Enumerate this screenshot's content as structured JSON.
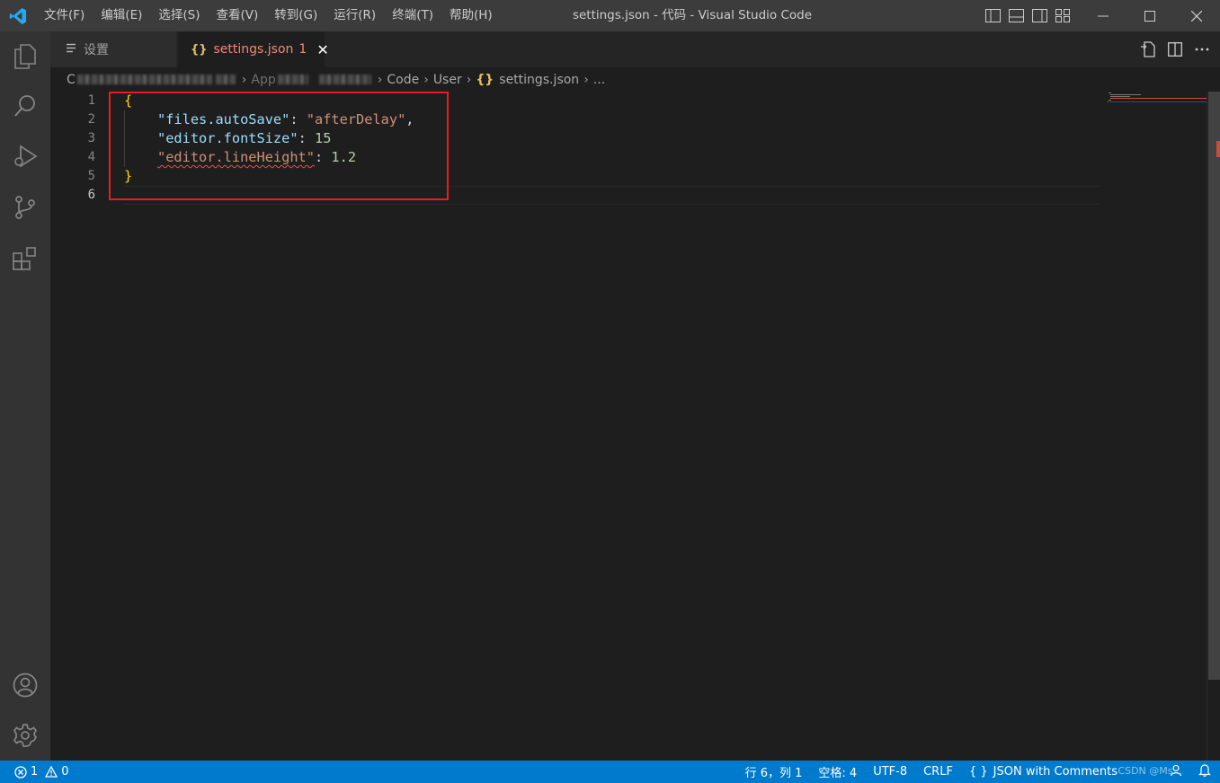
{
  "titlebar": {
    "menu": [
      "文件(F)",
      "编辑(E)",
      "选择(S)",
      "查看(V)",
      "转到(G)",
      "运行(R)",
      "终端(T)",
      "帮助(H)"
    ],
    "window_title": "settings.json - 代码 - Visual Studio Code"
  },
  "tabs": {
    "settings_label": "设置",
    "json_label": "settings.json",
    "json_problem_count": "1",
    "close_glyph": "✕"
  },
  "breadcrumb": {
    "start": "C",
    "part_app": "App",
    "part_code": "Code",
    "part_user": "User",
    "part_file": "settings.json",
    "part_more": "..."
  },
  "editor": {
    "line_numbers": [
      "1",
      "2",
      "3",
      "4",
      "5",
      "6"
    ],
    "lines": {
      "l1_open": "{",
      "l2_key": "\"files.autoSave\"",
      "l2_colon": ": ",
      "l2_value": "\"afterDelay\"",
      "l2_comma": ",",
      "l3_key": "\"editor.fontSize\"",
      "l3_colon": ": ",
      "l3_value": "15",
      "l4_key": "\"editor.lineHeight\"",
      "l4_colon": ": ",
      "l4_value": "1.2",
      "l5_close": "}"
    }
  },
  "statusbar": {
    "errors": "1",
    "warnings": "0",
    "cursor": "行 6，列 1",
    "indent": "空格: 4",
    "encoding": "UTF-8",
    "eol": "CRLF",
    "language_icon": "{ }",
    "language": "JSON with Comments",
    "watermark": "CSDN @Ms..."
  },
  "colors": {
    "accent": "#007acc",
    "highlight_box": "#e51e1e",
    "tab_problem_text": "#f48771"
  },
  "icons": [
    "vscode-logo",
    "explorer-icon",
    "search-icon",
    "run-debug-icon",
    "source-control-icon",
    "extensions-icon",
    "account-icon",
    "manage-gear-icon",
    "open-settings-ui-icon",
    "split-editor-icon",
    "more-actions-icon"
  ]
}
